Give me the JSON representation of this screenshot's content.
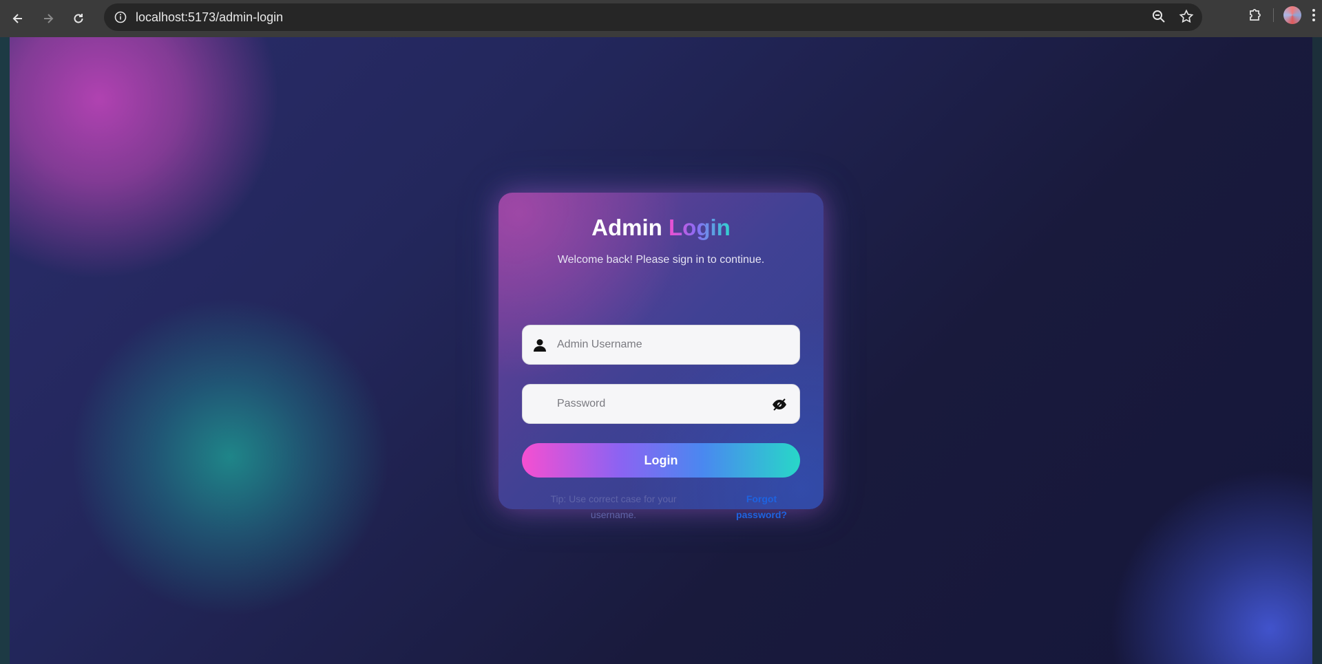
{
  "browser": {
    "url": "localhost:5173/admin-login",
    "icons": {
      "back": "back-arrow-icon",
      "forward": "forward-arrow-icon",
      "reload": "reload-icon",
      "info": "site-info-icon",
      "zoom": "zoom-out-icon",
      "bookmark": "star-icon",
      "extensions": "puzzle-icon",
      "menu": "kebab-menu-icon"
    }
  },
  "login": {
    "title_main": "Admin",
    "title_accent": "Login",
    "subtitle": "Welcome back! Please sign in to continue.",
    "username_placeholder": "Admin Username",
    "password_placeholder": "Password",
    "login_button": "Login",
    "tip": "Tip: Use correct case for your username.",
    "forgot_link": "Forgot password?"
  },
  "colors": {
    "accent_pink": "#f54fd1",
    "accent_purple": "#8c63f2",
    "accent_teal": "#28d7c8",
    "link_blue": "#1e63e0"
  }
}
